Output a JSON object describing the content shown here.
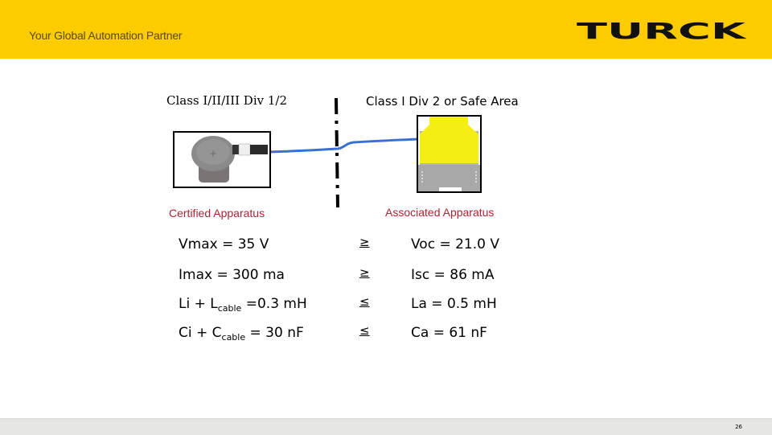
{
  "header": {
    "tagline": "Your Global Automation Partner",
    "logo_text": "TURCK",
    "brand_color": "#fdcc00"
  },
  "diagram": {
    "hazardous_zone_label": "Class I/II/III Div 1/2",
    "safe_zone_label": "Class I Div 2 or Safe Area",
    "certified_label": "Certified Apparatus",
    "associated_label": "Associated Apparatus",
    "cable_color": "#3a6fd8",
    "label_color": "#b22234"
  },
  "comparisons": [
    {
      "left": "Vmax = 35 V",
      "relation": "≥",
      "right": "Voc = 21.0 V"
    },
    {
      "left": "Imax = 300 ma",
      "relation": "≥",
      "right": "Isc = 86 mA"
    },
    {
      "left_prefix": "Li + L",
      "left_sub": "cable",
      "left_suffix": " =0.3 mH",
      "relation": "≤",
      "right": "La = 0.5 mH"
    },
    {
      "left_prefix": "Ci + C",
      "left_sub": "cable",
      "left_suffix": " = 30 nF",
      "relation": "≤",
      "right": "Ca = 61 nF"
    }
  ],
  "footer": {
    "page_number": "26"
  }
}
